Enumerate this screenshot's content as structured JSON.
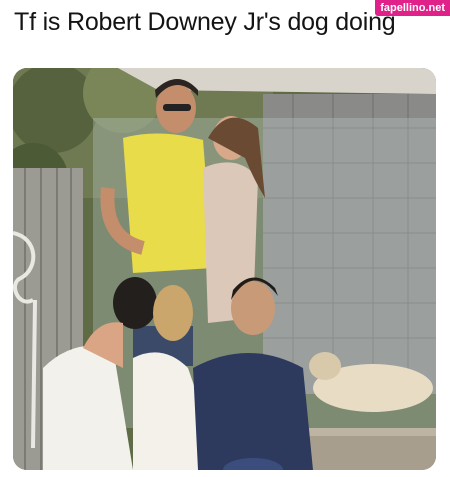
{
  "post": {
    "caption": "Tf is Robert Downey Jr's dog doing",
    "watermark": "fapellino.net"
  }
}
